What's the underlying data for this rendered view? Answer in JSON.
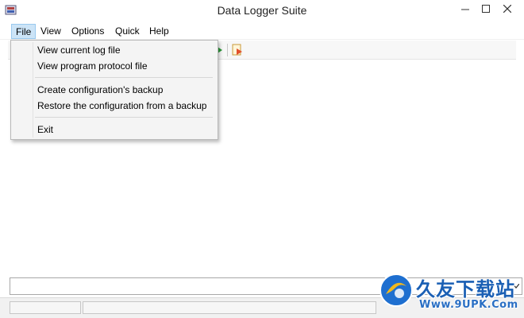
{
  "window": {
    "title": "Data Logger Suite",
    "app_icon": "data-logger-app-icon",
    "controls": [
      "minimize-icon",
      "maximize-icon",
      "close-icon"
    ]
  },
  "menubar": {
    "items": [
      {
        "label": "File",
        "open": true
      },
      {
        "label": "View"
      },
      {
        "label": "Options"
      },
      {
        "label": "Quick"
      },
      {
        "label": "Help"
      }
    ]
  },
  "file_menu": {
    "items": [
      {
        "label": "View current log file"
      },
      {
        "label": "View program protocol file"
      },
      {
        "separator": true
      },
      {
        "label": "Create configuration's backup"
      },
      {
        "label": "Restore the configuration from a backup"
      },
      {
        "separator": true
      },
      {
        "label": "Exit"
      }
    ]
  },
  "toolbar": {
    "icons": [
      "play-icon",
      "export-icon"
    ]
  },
  "bottom_combo": {
    "value": "",
    "arrow_icon": "chevron-down-icon"
  },
  "statusbar": {
    "panels": [
      "",
      ""
    ]
  },
  "watermark": {
    "text": "久友下载站",
    "url": "Www.9UPK.Com"
  },
  "colors": {
    "menu_highlight": "#cce4f7",
    "watermark_blue": "#1a5fb4"
  }
}
